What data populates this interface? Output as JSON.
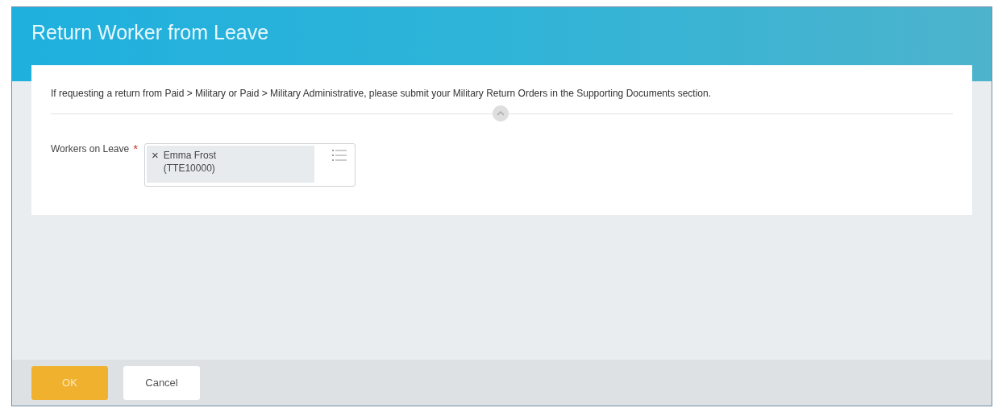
{
  "window": {
    "title": "Return Worker from Leave"
  },
  "message": "If requesting a return from Paid > Military or Paid > Military Administrative, please submit your Military Return Orders in the Supporting Documents section.",
  "field": {
    "label": "Workers on Leave",
    "required_mark": "*",
    "tokens": [
      {
        "remove": "×",
        "text": "Emma Frost (TTE10000)"
      }
    ]
  },
  "buttons": [
    {
      "label": "OK",
      "kind": "primary"
    },
    {
      "label": "Cancel",
      "kind": "secondary"
    }
  ]
}
